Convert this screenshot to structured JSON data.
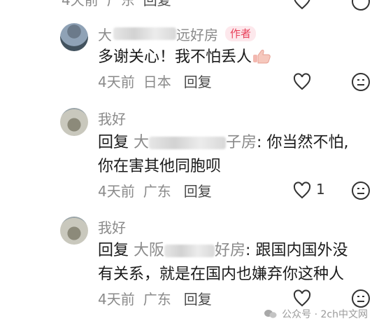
{
  "top_partial": {
    "time": "4天前",
    "location": "广东",
    "reply_label": "回复"
  },
  "comments": [
    {
      "name_prefix": "大",
      "name_suffix": "远好房",
      "author_tag": "作者",
      "lines": [
        "多谢关心！我不怕丢人"
      ],
      "time": "4天前",
      "location": "日本",
      "reply_label": "回复",
      "likes": ""
    },
    {
      "name": "我好",
      "reply_prefix": "回复",
      "target_prefix": "大",
      "target_suffix": "子房",
      "line1_text": ": 你当然不怕,",
      "line2": "你在害其他同胞呗",
      "time": "4天前",
      "location": "广东",
      "reply_label": "回复",
      "likes": "1"
    },
    {
      "name": "我好",
      "reply_prefix": "回复",
      "target_prefix": "大阪",
      "target_suffix": "好房",
      "line1_text": ": 跟国内国外没",
      "line2": "有关系，就是在国内也嫌弃你这种人",
      "time": "4天前",
      "location": "广东",
      "reply_label": "回复",
      "likes": ""
    }
  ],
  "watermark": {
    "text": "公众号 · 2ch中文网"
  },
  "colors": {
    "author_tag": "#e8425b",
    "meta_gray": "#8a8a8a"
  }
}
